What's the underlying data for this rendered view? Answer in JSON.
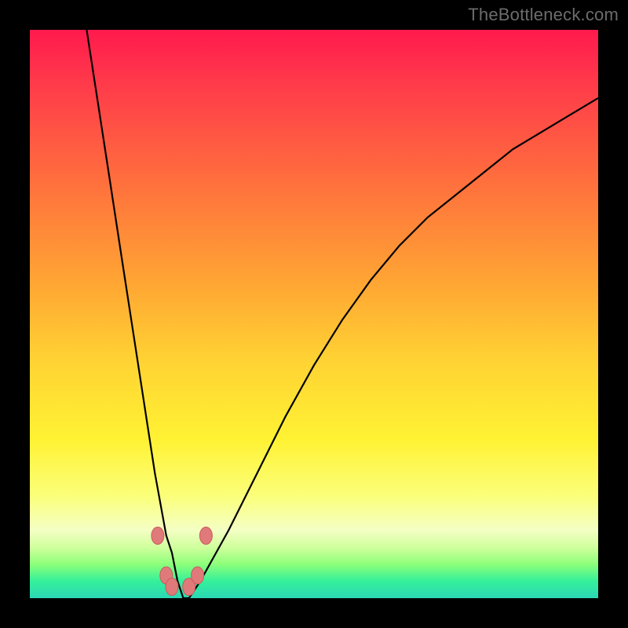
{
  "watermark": "TheBottleneck.com",
  "colors": {
    "frame": "#000000",
    "gradient_top": "#ff1a4d",
    "gradient_bottom": "#2bd7b5",
    "curve": "#000000",
    "marker_fill": "#e07a7a",
    "marker_stroke": "#c95a5a"
  },
  "chart_data": {
    "type": "line",
    "title": "",
    "xlabel": "",
    "ylabel": "",
    "xlim": [
      0,
      100
    ],
    "ylim": [
      0,
      100
    ],
    "grid": false,
    "legend": false,
    "series": [
      {
        "name": "bottleneck-curve",
        "x": [
          10,
          12,
          14,
          16,
          18,
          20,
          22,
          24,
          25,
          26,
          27,
          28,
          30,
          35,
          40,
          45,
          50,
          55,
          60,
          65,
          70,
          75,
          80,
          85,
          90,
          95,
          100
        ],
        "y": [
          100,
          87,
          74,
          61,
          48,
          35,
          22,
          11,
          8,
          3,
          0,
          0,
          3,
          12,
          22,
          32,
          41,
          49,
          56,
          62,
          67,
          71,
          75,
          79,
          82,
          85,
          88
        ]
      }
    ],
    "markers": [
      {
        "x": 22.5,
        "y": 11
      },
      {
        "x": 24.0,
        "y": 4
      },
      {
        "x": 25.0,
        "y": 2
      },
      {
        "x": 28.0,
        "y": 2
      },
      {
        "x": 29.5,
        "y": 4
      },
      {
        "x": 31.0,
        "y": 11
      }
    ],
    "background_gradient": {
      "direction": "vertical",
      "stops": [
        {
          "pos": 0.0,
          "color": "#ff1a4d"
        },
        {
          "pos": 0.45,
          "color": "#ffa733"
        },
        {
          "pos": 0.72,
          "color": "#fff233"
        },
        {
          "pos": 0.88,
          "color": "#f4ffc4"
        },
        {
          "pos": 1.0,
          "color": "#2bd7b5"
        }
      ]
    }
  }
}
